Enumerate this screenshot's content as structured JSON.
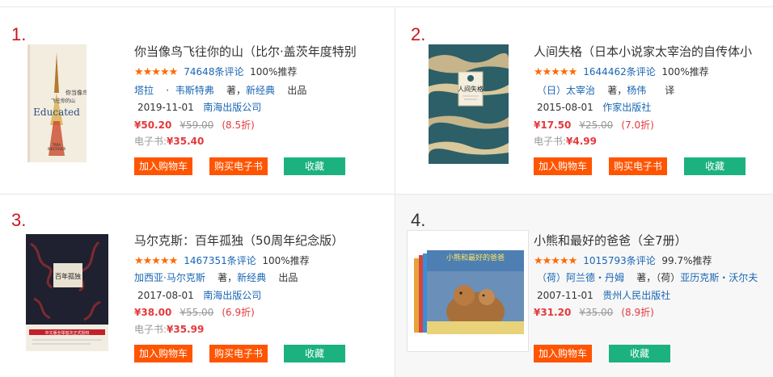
{
  "colors": {
    "rank_accent": "#c9151e",
    "price": "#e4393c",
    "link": "#1a66b3",
    "cart_button": "#ff5400",
    "favorite_button": "#1bb27f",
    "stars": "#ff6a00"
  },
  "stars": "★★★★★",
  "books": [
    {
      "rank": "1.",
      "title": "你当像鸟飞往你的山（比尔·盖茨年度特别",
      "reviews": "74648条评论",
      "recommend": "100%推荐",
      "authors_line": [
        {
          "text": "塔拉",
          "link": true
        },
        {
          "text": "·",
          "link": false
        },
        {
          "text": "韦斯特弗",
          "link": true
        },
        {
          "text": "著，",
          "link": false
        },
        {
          "text": "新经典",
          "link": true
        },
        {
          "text": "出品",
          "link": false
        }
      ],
      "date": "2019-11-01",
      "publisher": "南海出版公司",
      "price": "¥50.20",
      "original_price": "¥59.00",
      "discount": "(8.5折)",
      "ebook_label": "电子书:",
      "ebook_price": "¥35.40",
      "cover": {
        "title_cn": "你当像鸟\n飞往你的山",
        "title_en": "Educated",
        "author": "TARA\nWESTOVER"
      }
    },
    {
      "rank": "2.",
      "title": "人间失格（日本小说家太宰治的自传体小",
      "reviews": "1644462条评论",
      "recommend": "100%推荐",
      "authors_line": [
        {
          "text": "（日）太宰治",
          "link": true
        },
        {
          "text": "著，",
          "link": false
        },
        {
          "text": "杨伟",
          "link": true
        },
        {
          "text": "译",
          "link": false
        }
      ],
      "date": "2015-08-01",
      "publisher": "作家出版社",
      "price": "¥17.50",
      "original_price": "¥25.00",
      "discount": "(7.0折)",
      "ebook_label": "电子书:",
      "ebook_price": "¥4.99",
      "cover": {
        "title_cn": "人间失格"
      }
    },
    {
      "rank": "3.",
      "title": "马尔克斯：百年孤独（50周年纪念版）",
      "reviews": "1467351条评论",
      "recommend": "100%推荐",
      "authors_line": [
        {
          "text": "加西亚·马尔克斯",
          "link": true
        },
        {
          "text": "著，",
          "link": false
        },
        {
          "text": "新经典",
          "link": true
        },
        {
          "text": "出品",
          "link": false
        }
      ],
      "date": "2017-08-01",
      "publisher": "南海出版公司",
      "price": "¥38.00",
      "original_price": "¥55.00",
      "discount": "(6.9折)",
      "ebook_label": "电子书:",
      "ebook_price": "¥35.99",
      "cover": {
        "title_cn": "百年孤独",
        "banner": "中文版全球首次正式授权"
      }
    },
    {
      "rank": "4.",
      "title": "小熊和最好的爸爸（全7册）",
      "reviews": "1015793条评论",
      "recommend": "99.7%推荐",
      "authors_line": [
        {
          "text": "（荷）阿兰德・丹姆",
          "link": true
        },
        {
          "text": "著，（荷）",
          "link": false
        },
        {
          "text": "亚历克斯・沃尔夫",
          "link": true
        }
      ],
      "date": "2007-11-01",
      "publisher": "贵州人民出版社",
      "price": "¥31.20",
      "original_price": "¥35.00",
      "discount": "(8.9折)",
      "cover": {
        "title_cn": "小熊和最好的爸爸"
      }
    }
  ],
  "buttons": {
    "cart": "加入购物车",
    "ebook": "购买电子书",
    "favorite": "收藏"
  }
}
